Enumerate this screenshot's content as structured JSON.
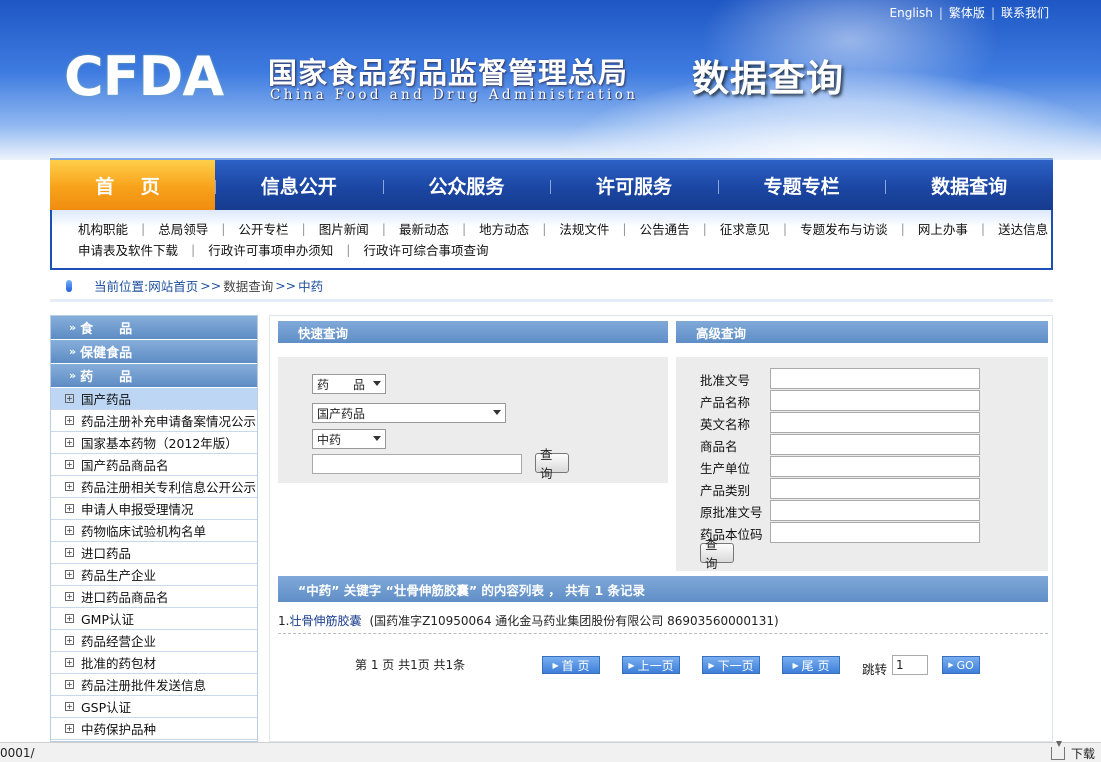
{
  "top_links": [
    "English",
    "繁体版",
    "联系我们"
  ],
  "logo_text": "CFDA",
  "org_name_cn": "国家食品药品监督管理总局",
  "org_name_en": "China Food and Drug Administration",
  "site_subtitle": "数据查询",
  "main_nav": [
    "首 页",
    "信息公开",
    "公众服务",
    "许可服务",
    "专题专栏",
    "数据查询"
  ],
  "sub_nav_row1": [
    "机构职能",
    "总局领导",
    "公开专栏",
    "图片新闻",
    "最新动态",
    "地方动态",
    "法规文件",
    "公告通告",
    "征求意见",
    "专题发布与访谈",
    "网上办事",
    "送达信息"
  ],
  "sub_nav_row2": [
    "申请表及软件下载",
    "行政许可事项申办须知",
    "行政许可综合事项查询"
  ],
  "breadcrumb": {
    "label": "当前位置:",
    "home": "网站首页",
    "arrow": ">>",
    "section": "数据查询",
    "current": "中药"
  },
  "left_menu": {
    "categories": {
      "food": "食　　品",
      "health_food": "保健食品",
      "drugs": "药　　品"
    },
    "drug_items": [
      "国产药品",
      "药品注册补充申请备案情况公示",
      "国家基本药物（2012年版）",
      "国产药品商品名",
      "药品注册相关专利信息公开公示",
      "申请人申报受理情况",
      "药物临床试验机构名单",
      "进口药品",
      "药品生产企业",
      "进口药品商品名",
      "GMP认证",
      "药品经营企业",
      "批准的药包材",
      "药品注册批件发送信息",
      "GSP认证",
      "中药保护品种"
    ]
  },
  "quick_query": {
    "title": "快速查询",
    "select1": "药　　品",
    "select2": "国产药品",
    "select3": "中药",
    "input": "",
    "button": "查询"
  },
  "advanced_query": {
    "title": "高级查询",
    "fields": [
      "批准文号",
      "产品名称",
      "英文名称",
      "商品名",
      "生产单位",
      "产品类别",
      "原批准文号",
      "药品本位码"
    ],
    "button": "查询"
  },
  "results": {
    "header": "“中药” 关键字 “壮骨伸筋胶囊” 的内容列表 ， 共有 1 条记录",
    "items": [
      {
        "index": "1.",
        "name": "壮骨伸筋胶囊",
        "detail": "(国药准字Z10950064 通化金马药业集团股份有限公司 86903560000131)"
      }
    ]
  },
  "pager": {
    "info": "第 1 页 共1页 共1条",
    "first": "首 页",
    "prev": "上一页",
    "next": "下一页",
    "last": "尾 页",
    "jump_label": "跳转",
    "jump_value": "1",
    "go": "GO"
  },
  "status_bar": {
    "url": "0001/",
    "download": "下载"
  },
  "colors": {
    "brand_blue": "#1b46a3",
    "nav_active_orange": "#f7a21a",
    "panel_header_blue": "#6f9bd0",
    "left_menu_active": "#bcd6f4"
  },
  "icons": [
    "expand-box-icon",
    "double-chevron-icon",
    "breadcrumb-pill-icon",
    "download-icon",
    "triangle-right-icon"
  ]
}
